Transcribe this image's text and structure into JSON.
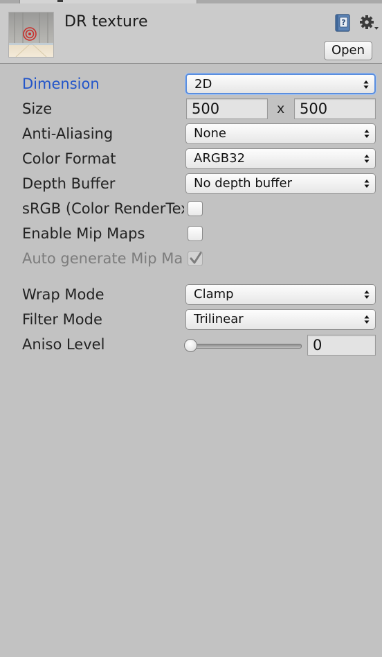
{
  "header": {
    "title": "DR texture",
    "open_label": "Open",
    "help_icon": "reference-book-icon",
    "settings_icon": "gear-icon"
  },
  "properties": {
    "dimension": {
      "label": "Dimension",
      "value": "2D"
    },
    "size": {
      "label": "Size",
      "width": "500",
      "separator": "x",
      "height": "500"
    },
    "anti_aliasing": {
      "label": "Anti-Aliasing",
      "value": "None"
    },
    "color_format": {
      "label": "Color Format",
      "value": "ARGB32"
    },
    "depth_buffer": {
      "label": "Depth Buffer",
      "value": "No depth buffer"
    },
    "srgb": {
      "label": "sRGB (Color RenderTexture)",
      "checked": false
    },
    "enable_mip_maps": {
      "label": "Enable Mip Maps",
      "checked": false
    },
    "auto_generate_mip_maps": {
      "label": "Auto generate Mip Maps",
      "checked": true,
      "enabled": false
    },
    "wrap_mode": {
      "label": "Wrap Mode",
      "value": "Clamp"
    },
    "filter_mode": {
      "label": "Filter Mode",
      "value": "Trilinear"
    },
    "aniso_level": {
      "label": "Aniso Level",
      "value": "0",
      "slider_fraction": 0
    }
  },
  "colors": {
    "panel_bg": "#c2c2c2",
    "focused_label": "#2355c9",
    "focus_ring": "#5b8ede"
  }
}
